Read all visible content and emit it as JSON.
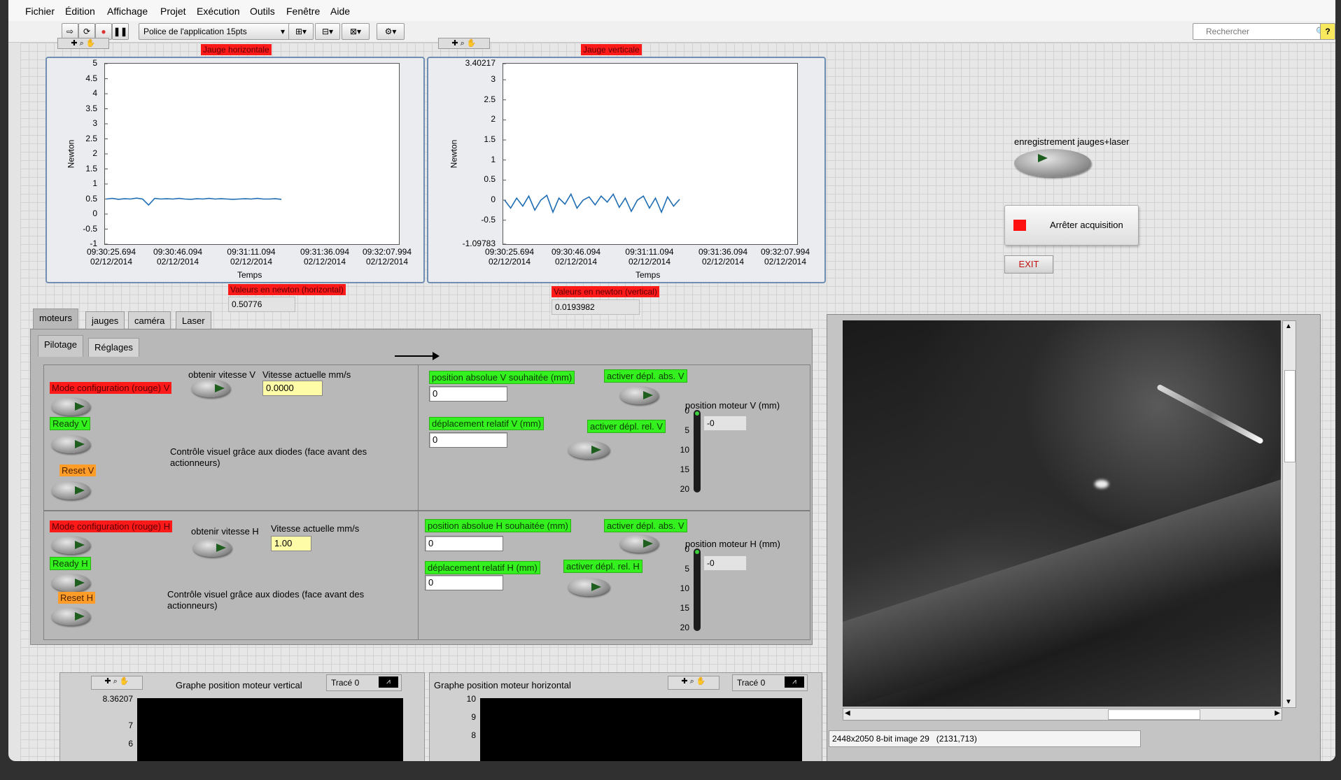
{
  "menu": [
    "Fichier",
    "Édition",
    "Affichage",
    "Projet",
    "Exécution",
    "Outils",
    "Fenêtre",
    "Aide"
  ],
  "toolbar": {
    "font_label": "Police de l'application 15pts",
    "search_placeholder": "Rechercher",
    "help_glyph": "?"
  },
  "chart_data": [
    {
      "type": "line",
      "title": "Jauge horizontale",
      "xlabel": "Temps",
      "ylabel": "Newton",
      "ylim": [
        -1,
        5
      ],
      "yticks": [
        "5",
        "4.5",
        "4",
        "3.5",
        "3",
        "2.5",
        "2",
        "1.5",
        "1",
        "0.5",
        "0",
        "-0.5",
        "-1"
      ],
      "xticks": [
        [
          "09:30:25.694",
          "02/12/2014"
        ],
        [
          "09:30:46.094",
          "02/12/2014"
        ],
        [
          "09:31:11.094",
          "02/12/2014"
        ],
        [
          "09:31:36.094",
          "02/12/2014"
        ],
        [
          "09:32:07.994",
          "02/12/2014"
        ]
      ],
      "series": [
        {
          "values": [
            0.5,
            0.52,
            0.49,
            0.51,
            0.5,
            0.53,
            0.5,
            0.3,
            0.52,
            0.5,
            0.51,
            0.5,
            0.52,
            0.5,
            0.49,
            0.51,
            0.5,
            0.52,
            0.5,
            0.51,
            0.5,
            0.49,
            0.5,
            0.51,
            0.5,
            0.52,
            0.5,
            0.5,
            0.51,
            0.49
          ]
        }
      ],
      "value_label": "Valeurs en newton (horizontal)",
      "value": "0.50776"
    },
    {
      "type": "line",
      "title": "Jauge verticale",
      "xlabel": "Temps",
      "ylabel": "Newton",
      "ylim": [
        -1.09783,
        3.40217
      ],
      "yticks": [
        "3.40217",
        "3",
        "2.5",
        "2",
        "1.5",
        "1",
        "0.5",
        "0",
        "-0.5",
        "-1.09783"
      ],
      "xticks": [
        [
          "09:30:25.694",
          "02/12/2014"
        ],
        [
          "09:30:46.094",
          "02/12/2014"
        ],
        [
          "09:31:11.094",
          "02/12/2014"
        ],
        [
          "09:31:36.094",
          "02/12/2014"
        ],
        [
          "09:32:07.994",
          "02/12/2014"
        ]
      ],
      "series": [
        {
          "values": [
            0,
            -0.2,
            0.05,
            -0.15,
            0.1,
            -0.25,
            0,
            0.12,
            -0.3,
            0.05,
            -0.1,
            0.15,
            -0.2,
            0,
            0.08,
            -0.12,
            0.1,
            -0.05,
            0.15,
            -0.18,
            0.05,
            -0.28,
            0,
            0.1,
            -0.2,
            0.05,
            -0.3,
            0.08,
            -0.15,
            0.02
          ]
        }
      ],
      "value_label": "Valeurs en newton (vertical)",
      "value": "0.0193982"
    }
  ],
  "controls": {
    "record_label": "enregistrement jauges+laser",
    "stop_label": "Arrêter acquisition",
    "exit_label": "EXIT"
  },
  "tabs": [
    "moteurs",
    "jauges",
    "caméra",
    "Laser"
  ],
  "subtabs": [
    "Pilotage",
    "Réglages"
  ],
  "v_section": {
    "mode": "Mode configuration (rouge) V",
    "ready": "Ready V",
    "reset": "Reset V",
    "get_speed": "obtenir vitesse V",
    "speed_label": "Vitesse actuelle mm/s",
    "speed": "0.0000",
    "visual": "Contrôle visuel grâce aux diodes (face avant des actionneurs)",
    "abs_label": "position absolue V souhaitée (mm)",
    "abs_value": "0",
    "abs_btn": "activer dépl. abs. V",
    "rel_label": "déplacement relatif V (mm)",
    "rel_value": "0",
    "rel_btn": "activer dépl. rel. V",
    "motor_label": "position moteur V (mm)",
    "motor_value": "-0",
    "ticks": [
      "0",
      "5",
      "10",
      "15",
      "20"
    ]
  },
  "h_section": {
    "mode": "Mode configuration (rouge) H",
    "ready": "Ready H",
    "reset": "Reset H",
    "get_speed": "obtenir vitesse H",
    "speed_label": "Vitesse actuelle mm/s",
    "speed": "1.00",
    "visual": "Contrôle visuel grâce aux diodes (face avant des actionneurs)",
    "abs_label": "position absolue H souhaitée (mm)",
    "abs_value": "0",
    "abs_btn": "activer dépl. abs. V",
    "rel_label": "déplacement relatif H (mm)",
    "rel_value": "0",
    "rel_btn": "activer dépl. rel. H",
    "motor_label": "position moteur H (mm)",
    "motor_value": "-0",
    "ticks": [
      "0",
      "5",
      "10",
      "15",
      "20"
    ]
  },
  "bottom": {
    "graph_v": "Graphe position moteur vertical",
    "graph_h": "Graphe position moteur horizontal",
    "trace": "Tracé 0",
    "v_ticks": [
      "8.36207",
      "7",
      "6"
    ],
    "h_ticks": [
      "10",
      "9",
      "8"
    ]
  },
  "image": {
    "status": "2448x2050 8-bit image 29",
    "coords": "(2131,713)"
  }
}
